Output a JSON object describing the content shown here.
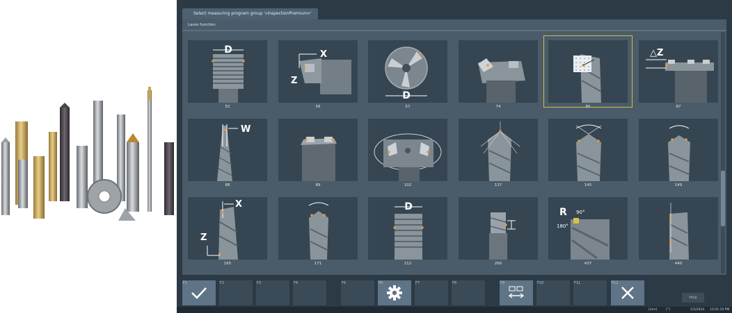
{
  "window": {
    "tab_title": "Select measuring program group '»InspectionPremium«'",
    "section_label": "Lasso function"
  },
  "tiles": [
    {
      "number": "52",
      "icon": "drill-thread-D-icon",
      "selected": false
    },
    {
      "number": "56",
      "icon": "insert-holder-XZ-icon",
      "selected": false
    },
    {
      "number": "57",
      "icon": "three-flute-cutter-D-icon",
      "selected": false
    },
    {
      "number": "74",
      "icon": "square-insert-cutter-icon",
      "selected": false
    },
    {
      "number": "80",
      "icon": "drill-grid-lasso-icon",
      "selected": true
    },
    {
      "number": "87",
      "icon": "face-mill-deltaZ-icon",
      "selected": false
    },
    {
      "number": "88",
      "icon": "tapered-drill-W-icon",
      "selected": false
    },
    {
      "number": "89",
      "icon": "end-mill-cylinder-icon",
      "selected": false
    },
    {
      "number": "102",
      "icon": "indexable-cutter-rotation-icon",
      "selected": false
    },
    {
      "number": "137",
      "icon": "drill-tip-angle-lines-icon",
      "selected": false
    },
    {
      "number": "145",
      "icon": "drill-point-angle-icon",
      "selected": false
    },
    {
      "number": "149",
      "icon": "drill-point-angle-small-icon",
      "selected": false
    },
    {
      "number": "165",
      "icon": "drill-XZ-icon",
      "selected": false
    },
    {
      "number": "171",
      "icon": "drill-angle-mark-icon",
      "selected": false
    },
    {
      "number": "212",
      "icon": "thread-mill-D-icon",
      "selected": false
    },
    {
      "number": "260",
      "icon": "step-tool-icon",
      "selected": false
    },
    {
      "number": "437",
      "icon": "end-mill-radius-R-icon",
      "selected": false
    },
    {
      "number": "440",
      "icon": "drill-line-marks-icon",
      "selected": false
    }
  ],
  "r_annot": {
    "r": "R",
    "a1": "90°",
    "a2": "180°"
  },
  "letters": {
    "D": "D",
    "X": "X",
    "Z": "Z",
    "W": "W",
    "dz": "△Z"
  },
  "fkeys": [
    {
      "label": "F1",
      "icon": "checkmark-icon",
      "active": true
    },
    {
      "label": "F2",
      "icon": "",
      "active": false
    },
    {
      "label": "F3",
      "icon": "",
      "active": false
    },
    {
      "label": "F4",
      "icon": "",
      "active": false
    },
    {
      "label": "F5",
      "icon": "",
      "active": false
    },
    {
      "label": "F6",
      "icon": "gear-icon",
      "active": true
    },
    {
      "label": "F7",
      "icon": "",
      "active": false
    },
    {
      "label": "F8",
      "icon": "",
      "active": false
    },
    {
      "label": "F9",
      "icon": "switch-view-icon",
      "active": true
    },
    {
      "label": "F10",
      "icon": "",
      "active": false
    },
    {
      "label": "F11",
      "icon": "",
      "active": false
    },
    {
      "label": "F12",
      "icon": "close-icon",
      "active": true
    }
  ],
  "help_label": "Help",
  "status": {
    "unit": "[mm]",
    "marker": "[°]",
    "date": "1/5/2024",
    "time": "12:01:10 PM"
  },
  "colors": {
    "accent_selection": "#d5c23f",
    "tool_orange": "#e39a3b",
    "panel": "#4a5b69",
    "background": "#2c3a46"
  }
}
